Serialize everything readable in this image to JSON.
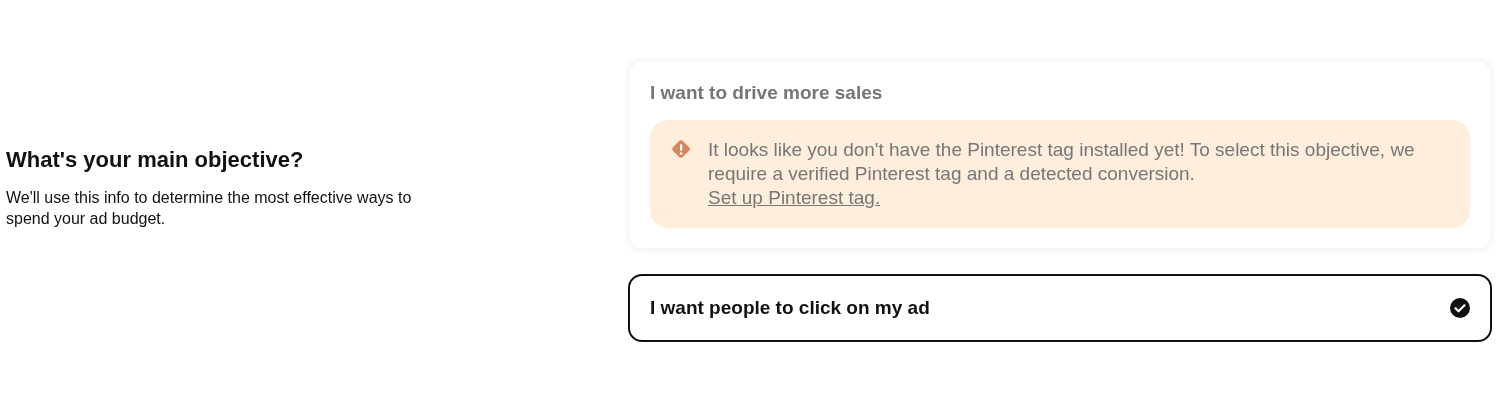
{
  "heading": "What's your main objective?",
  "description": "We'll use this info to determine the most effective ways to spend your ad budget.",
  "options": [
    {
      "label": "I want to drive more sales",
      "selected": false,
      "disabled": true,
      "warning": {
        "message": "It looks like you don't have the Pinterest tag installed yet! To select this objective, we require a verified Pinterest tag and a detected conversion.",
        "link": "Set up Pinterest tag."
      }
    },
    {
      "label": "I want people to click on my ad",
      "selected": true,
      "disabled": false
    }
  ]
}
